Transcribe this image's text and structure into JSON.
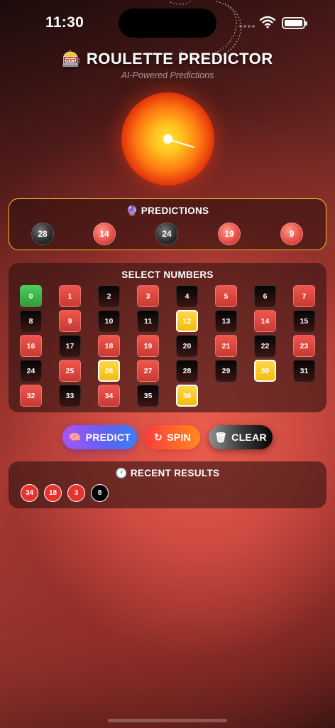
{
  "status_bar": {
    "time": "11:30"
  },
  "header": {
    "title": "🎰 ROULETTE PREDICTOR",
    "subtitle": "AI-Powered Predictions"
  },
  "predictions": {
    "title": "🔮 PREDICTIONS",
    "balls": [
      {
        "number": "28",
        "color": "black"
      },
      {
        "number": "14",
        "color": "red"
      },
      {
        "number": "24",
        "color": "black"
      },
      {
        "number": "19",
        "color": "red"
      },
      {
        "number": "9",
        "color": "red"
      }
    ]
  },
  "select_numbers": {
    "title": "SELECT NUMBERS",
    "cells": [
      {
        "number": "0",
        "color": "green",
        "selected": false
      },
      {
        "number": "1",
        "color": "red",
        "selected": false
      },
      {
        "number": "2",
        "color": "black",
        "selected": false
      },
      {
        "number": "3",
        "color": "red",
        "selected": false
      },
      {
        "number": "4",
        "color": "black",
        "selected": false
      },
      {
        "number": "5",
        "color": "red",
        "selected": false
      },
      {
        "number": "6",
        "color": "black",
        "selected": false
      },
      {
        "number": "7",
        "color": "red",
        "selected": false
      },
      {
        "number": "8",
        "color": "black",
        "selected": false
      },
      {
        "number": "9",
        "color": "red",
        "selected": false
      },
      {
        "number": "10",
        "color": "black",
        "selected": false
      },
      {
        "number": "11",
        "color": "black",
        "selected": false
      },
      {
        "number": "12",
        "color": "red",
        "selected": true
      },
      {
        "number": "13",
        "color": "black",
        "selected": false
      },
      {
        "number": "14",
        "color": "red",
        "selected": false
      },
      {
        "number": "15",
        "color": "black",
        "selected": false
      },
      {
        "number": "16",
        "color": "red",
        "selected": false
      },
      {
        "number": "17",
        "color": "black",
        "selected": false
      },
      {
        "number": "18",
        "color": "red",
        "selected": false
      },
      {
        "number": "19",
        "color": "red",
        "selected": false
      },
      {
        "number": "20",
        "color": "black",
        "selected": false
      },
      {
        "number": "21",
        "color": "red",
        "selected": false
      },
      {
        "number": "22",
        "color": "black",
        "selected": false
      },
      {
        "number": "23",
        "color": "red",
        "selected": false
      },
      {
        "number": "24",
        "color": "black",
        "selected": false
      },
      {
        "number": "25",
        "color": "red",
        "selected": false
      },
      {
        "number": "26",
        "color": "black",
        "selected": true
      },
      {
        "number": "27",
        "color": "red",
        "selected": false
      },
      {
        "number": "28",
        "color": "black",
        "selected": false
      },
      {
        "number": "29",
        "color": "black",
        "selected": false
      },
      {
        "number": "30",
        "color": "red",
        "selected": true
      },
      {
        "number": "31",
        "color": "black",
        "selected": false
      },
      {
        "number": "32",
        "color": "red",
        "selected": false
      },
      {
        "number": "33",
        "color": "black",
        "selected": false
      },
      {
        "number": "34",
        "color": "red",
        "selected": false
      },
      {
        "number": "35",
        "color": "black",
        "selected": false
      },
      {
        "number": "36",
        "color": "red",
        "selected": true
      }
    ]
  },
  "actions": {
    "predict": {
      "label": "PREDICT",
      "icon": "brain-icon"
    },
    "spin": {
      "label": "SPIN",
      "icon": "refresh-icon"
    },
    "clear": {
      "label": "CLEAR",
      "icon": "trash-icon"
    }
  },
  "recent_results": {
    "title": "🕐 RECENT RESULTS",
    "balls": [
      {
        "number": "34",
        "color": "red"
      },
      {
        "number": "18",
        "color": "red"
      },
      {
        "number": "3",
        "color": "red"
      },
      {
        "number": "8",
        "color": "black"
      }
    ]
  },
  "colors": {
    "accent_gold": "#f3c623",
    "roulette_red": "#e9322d",
    "roulette_black": "#050505",
    "roulette_green": "#3fb54c"
  }
}
